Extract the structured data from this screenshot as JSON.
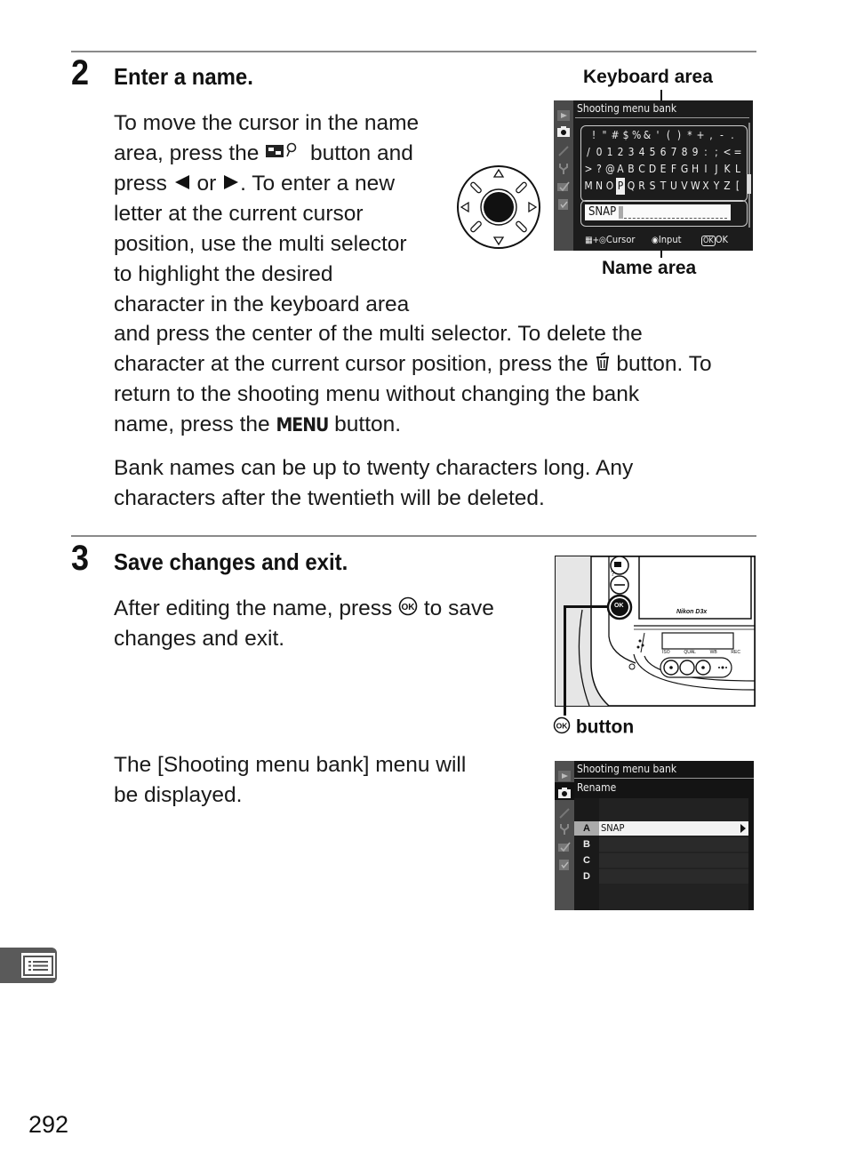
{
  "page_number": "292",
  "step2": {
    "number": "2",
    "title": "Enter a name.",
    "paragraph1_lines": [
      "To move the cursor in the name",
      [
        "area, press the ",
        "thumbnail-zoom-out-button-icon",
        " button and"
      ],
      [
        "press ",
        "left-arrow",
        " or ",
        "right-arrow",
        ".  To enter a new"
      ],
      "letter at the current cursor",
      "position, use the multi selector",
      "to highlight the desired",
      "character in the keyboard area",
      "and press the center of the multi selector.  To delete the",
      [
        "character at the current cursor position, press the ",
        "trash-icon",
        " button.  To"
      ],
      "return to the shooting menu without changing the bank",
      [
        "name, press the ",
        "MENU",
        " button."
      ]
    ],
    "l1": "To move the cursor in the name",
    "l2a": "area, press the ",
    "l2b": " button and",
    "l3a": "press ",
    "l3b": " or ",
    "l3c": ".  To enter a new",
    "l4": "letter at the current cursor",
    "l5": "position, use the multi selector",
    "l6": "to highlight the desired",
    "l7": "character in the keyboard area",
    "l8": "and press the center of the multi selector.  To delete the",
    "l9a": "character at the current cursor position, press the ",
    "l9b": " button.  To",
    "l10": "return to the shooting menu without changing the bank",
    "l11a": "name, press the ",
    "l11_menu": "MENU",
    "l11b": " button.",
    "paragraph2_l1": "Bank names can be up to twenty characters long.  Any",
    "paragraph2_l2": "characters after the twentieth will be deleted.",
    "callout_keyboard": "Keyboard area",
    "callout_name": "Name area",
    "screen": {
      "title": "Shooting menu bank",
      "keyboard_rows": [
        "! \" # $ % & ' ( ) * + , - .",
        "/ 0 1 2 3 4 5 6 7 8 9 : ; < =",
        "> ? @ A B C D E F G H I J K L",
        "M N O P Q R S T U V W X Y Z ["
      ],
      "selected_char": "P",
      "name_value": "SNAP",
      "footer_cursor": "Cursor",
      "footer_input": "Input",
      "footer_ok_badge": "OK",
      "footer_ok": "OK"
    }
  },
  "step3": {
    "number": "3",
    "title": "Save changes and exit.",
    "p1_l1a": "After editing the name, press ",
    "p1_l1b": " to save",
    "p1_l2": "changes and exit.",
    "ok_glyph": "OK",
    "callout_button": "button",
    "camera": {
      "brand": "Nikon",
      "model": "D3x",
      "lcd_labels": [
        "ISO",
        "QUAL",
        "WB",
        "REC"
      ],
      "ok_label": "OK"
    },
    "p2_l1": "The [Shooting menu bank] menu will",
    "p2_l2": "be displayed.",
    "screen2": {
      "title": "Shooting menu bank",
      "subtitle": "Rename",
      "rows": [
        {
          "letter": "A",
          "name": "SNAP",
          "selected": true
        },
        {
          "letter": "B",
          "name": "",
          "selected": false
        },
        {
          "letter": "C",
          "name": "",
          "selected": false
        },
        {
          "letter": "D",
          "name": "",
          "selected": false
        }
      ]
    }
  },
  "side_tab_icon": "menu-list-icon"
}
